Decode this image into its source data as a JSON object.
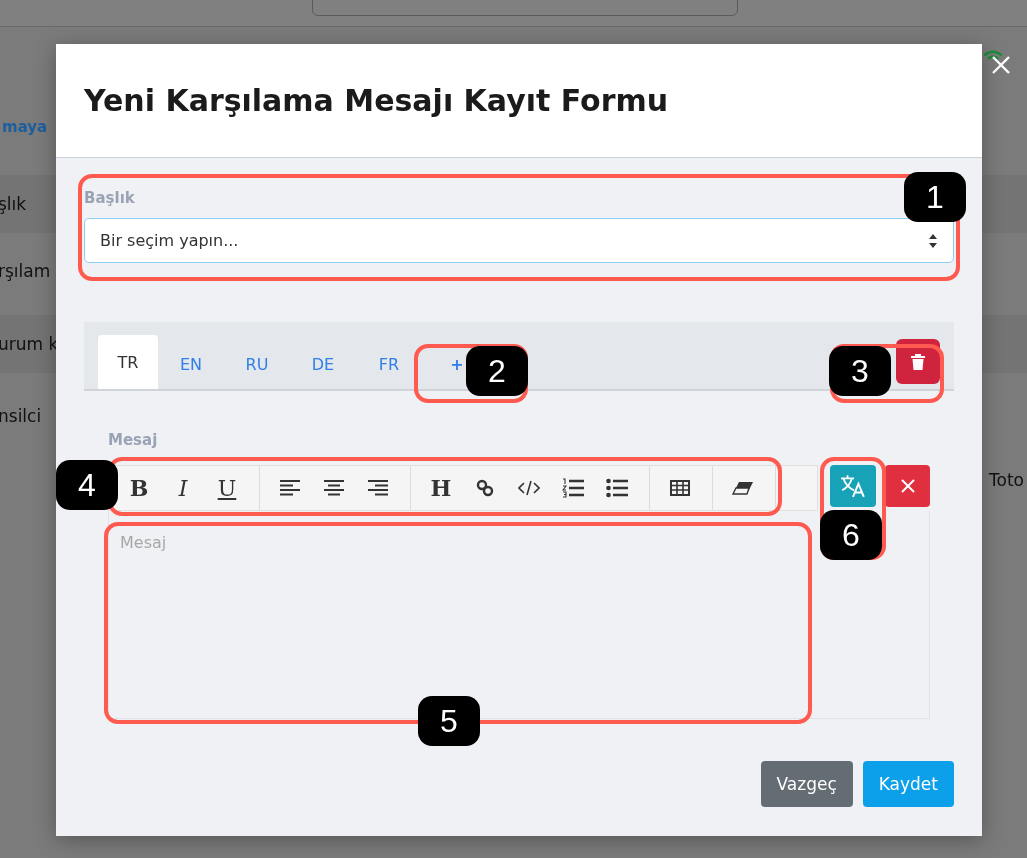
{
  "background_page": {
    "link": "maya",
    "rows": [
      "şlık",
      "rşılam",
      "urum k",
      "nsilci"
    ],
    "side_text": "Toto"
  },
  "modal": {
    "title": "Yeni Karşılama Mesajı Kayıt Formu",
    "title_field": {
      "label": "Başlık",
      "value": "Bir seçim yapın..."
    },
    "language_tabs": [
      {
        "label": "TR",
        "selected": true
      },
      {
        "label": "EN",
        "selected": false
      },
      {
        "label": "RU",
        "selected": false
      },
      {
        "label": "DE",
        "selected": false
      },
      {
        "label": "FR",
        "selected": false
      }
    ],
    "add_tab": "+",
    "message": {
      "label": "Mesaj",
      "placeholder": "Mesaj"
    },
    "toolbar": [
      [
        {
          "kind": "bold",
          "label": "B"
        },
        {
          "kind": "italic",
          "label": "I"
        },
        {
          "kind": "underline",
          "label": "U"
        }
      ],
      [
        {
          "kind": "align-left"
        },
        {
          "kind": "align-center"
        },
        {
          "kind": "align-right"
        }
      ],
      [
        {
          "kind": "heading",
          "label": "H"
        },
        {
          "kind": "link"
        },
        {
          "kind": "code"
        },
        {
          "kind": "ordered-list"
        },
        {
          "kind": "bullet-list"
        }
      ],
      [
        {
          "kind": "table"
        }
      ],
      [
        {
          "kind": "eraser"
        }
      ]
    ],
    "buttons": [
      {
        "label": "Vazgeç",
        "kind": "secondary"
      },
      {
        "label": "Kaydet",
        "kind": "primary"
      }
    ]
  },
  "callouts": [
    "1",
    "2",
    "3",
    "4",
    "5",
    "6"
  ]
}
